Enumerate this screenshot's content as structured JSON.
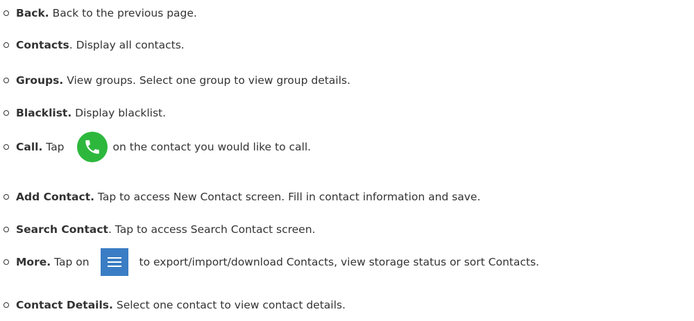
{
  "items": [
    {
      "lead": "Back.",
      "rest": " Back to the previous page."
    },
    {
      "lead": "Contacts",
      "rest": ". Display all contacts."
    },
    {
      "lead": "Groups.",
      "rest": " View groups. Select one group to view group details."
    },
    {
      "lead": "Blacklist.",
      "rest": " Display blacklist."
    },
    {
      "lead": "Call.",
      "before_icon": " Tap",
      "after_icon": "on the contact you would like to call.",
      "icon": "phone-icon"
    },
    {
      "lead": "Add Contact.",
      "rest": " Tap to access New Contact screen. Fill in contact information and save."
    },
    {
      "lead": "Search Contact",
      "rest": ". Tap to access Search Contact screen."
    },
    {
      "lead": "More.",
      "before_icon": " Tap on",
      "after_icon": "to export/import/download Contacts, view storage status or sort Contacts.",
      "icon": "menu-icon"
    },
    {
      "lead": "Contact Details.",
      "rest": " Select one contact to view contact details."
    }
  ],
  "colors": {
    "call_icon_bg": "#2db83d",
    "more_icon_bg": "#3a7dc4"
  }
}
